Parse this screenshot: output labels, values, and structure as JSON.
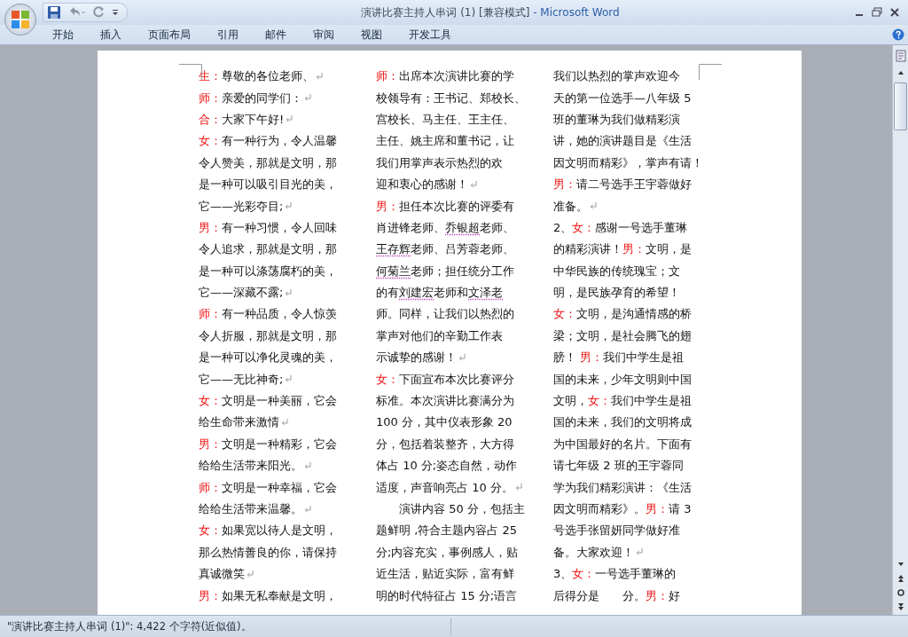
{
  "window": {
    "title_document": "演讲比赛主持人串词 (1) [兼容模式]",
    "title_app": "- Microsoft Word"
  },
  "ribbon_tabs": [
    {
      "label": "开始",
      "selected": false
    },
    {
      "label": "插入",
      "selected": false
    },
    {
      "label": "页面布局",
      "selected": false
    },
    {
      "label": "引用",
      "selected": false
    },
    {
      "label": "邮件",
      "selected": false
    },
    {
      "label": "审阅",
      "selected": false
    },
    {
      "label": "视图",
      "selected": false
    },
    {
      "label": "开发工具",
      "selected": false
    }
  ],
  "document": {
    "columns": [
      [
        {
          "segs": [
            {
              "kind": "speaker",
              "text": "生："
            },
            {
              "kind": "plain",
              "text": "尊敬的各位老师、"
            }
          ],
          "para_end": true
        },
        {
          "segs": [
            {
              "kind": "speaker",
              "text": "师："
            },
            {
              "kind": "plain",
              "text": "亲爱的同学们："
            }
          ],
          "para_end": true
        },
        {
          "segs": [
            {
              "kind": "speaker",
              "text": "合："
            },
            {
              "kind": "plain",
              "text": "大家下午好!"
            }
          ],
          "para_end": true
        },
        {
          "segs": [
            {
              "kind": "speaker",
              "text": "女："
            },
            {
              "kind": "plain",
              "text": "有一种行为，令人温馨"
            }
          ],
          "para_end": false
        },
        {
          "segs": [
            {
              "kind": "plain",
              "text": "令人赞美，那就是文明，那"
            }
          ],
          "para_end": false
        },
        {
          "segs": [
            {
              "kind": "plain",
              "text": "是一种可以吸引目光的美，"
            }
          ],
          "para_end": false
        },
        {
          "segs": [
            {
              "kind": "plain",
              "text": "它——光彩夺目;"
            }
          ],
          "para_end": true
        },
        {
          "segs": [
            {
              "kind": "speaker",
              "text": "男："
            },
            {
              "kind": "plain",
              "text": "有一种习惯，令人回味"
            }
          ],
          "para_end": false
        },
        {
          "segs": [
            {
              "kind": "plain",
              "text": "令人追求，那就是文明，那"
            }
          ],
          "para_end": false
        },
        {
          "segs": [
            {
              "kind": "plain",
              "text": "是一种可以涤荡腐朽的美，"
            }
          ],
          "para_end": false
        },
        {
          "segs": [
            {
              "kind": "plain",
              "text": "它——深藏不露;"
            }
          ],
          "para_end": true
        },
        {
          "segs": [
            {
              "kind": "speaker",
              "text": "师："
            },
            {
              "kind": "plain",
              "text": "有一种品质，令人惊羡"
            }
          ],
          "para_end": false
        },
        {
          "segs": [
            {
              "kind": "plain",
              "text": "令人折服，那就是文明，那"
            }
          ],
          "para_end": false
        },
        {
          "segs": [
            {
              "kind": "plain",
              "text": "是一种可以净化灵魂的美，"
            }
          ],
          "para_end": false
        },
        {
          "segs": [
            {
              "kind": "plain",
              "text": "它——无比神奇;"
            }
          ],
          "para_end": true
        },
        {
          "segs": [
            {
              "kind": "speaker",
              "text": "女："
            },
            {
              "kind": "plain",
              "text": "文明是一种美丽，它会"
            }
          ],
          "para_end": false
        },
        {
          "segs": [
            {
              "kind": "plain",
              "text": "给生命带来激情"
            }
          ],
          "para_end": true
        },
        {
          "segs": [
            {
              "kind": "speaker",
              "text": "男："
            },
            {
              "kind": "plain",
              "text": "文明是一种精彩，它会"
            }
          ],
          "para_end": false
        },
        {
          "segs": [
            {
              "kind": "plain",
              "text": "给给生活带来阳光。"
            }
          ],
          "para_end": true
        },
        {
          "segs": [
            {
              "kind": "speaker",
              "text": "师："
            },
            {
              "kind": "plain",
              "text": "文明是一种幸福，它会"
            }
          ],
          "para_end": false
        },
        {
          "segs": [
            {
              "kind": "plain",
              "text": "给给生活带来温馨。"
            }
          ],
          "para_end": true
        },
        {
          "segs": [
            {
              "kind": "speaker",
              "text": "女："
            },
            {
              "kind": "plain",
              "text": "如果宽以待人是文明，"
            }
          ],
          "para_end": false
        },
        {
          "segs": [
            {
              "kind": "plain",
              "text": "那么热情善良的你，请保持"
            }
          ],
          "para_end": false
        },
        {
          "segs": [
            {
              "kind": "plain",
              "text": "真诚微笑"
            }
          ],
          "para_end": true
        },
        {
          "segs": [
            {
              "kind": "speaker",
              "text": "男："
            },
            {
              "kind": "plain",
              "text": "如果无私奉献是文明，"
            }
          ],
          "para_end": false
        }
      ],
      [
        {
          "segs": [
            {
              "kind": "speaker",
              "text": "师："
            },
            {
              "kind": "plain",
              "text": "出席本次演讲比赛的学"
            }
          ],
          "para_end": false
        },
        {
          "segs": [
            {
              "kind": "plain",
              "text": "校领导有：王书记、郑校长、"
            }
          ],
          "para_end": false
        },
        {
          "segs": [
            {
              "kind": "plain",
              "text": "宫校长、马主任、王主任、"
            }
          ],
          "para_end": false
        },
        {
          "segs": [
            {
              "kind": "plain",
              "text": "主任、姚主席和董书记，让"
            }
          ],
          "para_end": false
        },
        {
          "segs": [
            {
              "kind": "plain",
              "text": "我们用掌声表示热烈的欢"
            }
          ],
          "para_end": false
        },
        {
          "segs": [
            {
              "kind": "plain",
              "text": "迎和衷心的感谢！"
            }
          ],
          "para_end": true
        },
        {
          "segs": [
            {
              "kind": "speaker",
              "text": "男："
            },
            {
              "kind": "plain",
              "text": "担任本次比赛的评委有"
            }
          ],
          "para_end": false
        },
        {
          "segs": [
            {
              "kind": "plain",
              "text": "肖进锋老师、"
            },
            {
              "kind": "flagged",
              "text": "乔银超"
            },
            {
              "kind": "plain",
              "text": "老师、"
            }
          ],
          "para_end": false
        },
        {
          "segs": [
            {
              "kind": "flagged",
              "text": "王存辉"
            },
            {
              "kind": "plain",
              "text": "老师、吕芳蓉老师、"
            }
          ],
          "para_end": false
        },
        {
          "segs": [
            {
              "kind": "flagged",
              "text": "何菊兰"
            },
            {
              "kind": "plain",
              "text": "老师；担任统分工作"
            }
          ],
          "para_end": false
        },
        {
          "segs": [
            {
              "kind": "plain",
              "text": "的有"
            },
            {
              "kind": "flagged",
              "text": "刘建宏"
            },
            {
              "kind": "plain",
              "text": "老师和"
            },
            {
              "kind": "flagged",
              "text": "文泽老"
            }
          ],
          "para_end": false
        },
        {
          "segs": [
            {
              "kind": "plain",
              "text": "师。同样，让我们以热烈的"
            }
          ],
          "para_end": false
        },
        {
          "segs": [
            {
              "kind": "plain",
              "text": "掌声对他们的辛勤工作表"
            }
          ],
          "para_end": false
        },
        {
          "segs": [
            {
              "kind": "plain",
              "text": "示诚挚的感谢！"
            }
          ],
          "para_end": true
        },
        {
          "segs": [
            {
              "kind": "speaker",
              "text": "女："
            },
            {
              "kind": "plain",
              "text": "下面宣布本次比赛评分"
            }
          ],
          "para_end": false
        },
        {
          "segs": [
            {
              "kind": "plain",
              "text": "标准。本次演讲比赛满分为"
            }
          ],
          "para_end": false
        },
        {
          "segs": [
            {
              "kind": "plain",
              "text": "100 分，其中仪表形象 20"
            }
          ],
          "para_end": false
        },
        {
          "segs": [
            {
              "kind": "plain",
              "text": "分，包括着装整齐，大方得"
            }
          ],
          "para_end": false
        },
        {
          "segs": [
            {
              "kind": "plain",
              "text": "体占 10 分;姿态自然，动作"
            }
          ],
          "para_end": false
        },
        {
          "segs": [
            {
              "kind": "plain",
              "text": "适度，声音响亮占 10 分。"
            }
          ],
          "para_end": true
        },
        {
          "segs": [
            {
              "kind": "plain",
              "text": "　　演讲内容 50 分，包括主"
            }
          ],
          "para_end": false
        },
        {
          "segs": [
            {
              "kind": "plain",
              "text": "题鲜明 ,符合主题内容占 25"
            }
          ],
          "para_end": false
        },
        {
          "segs": [
            {
              "kind": "plain",
              "text": "分;内容充实，事例感人，贴"
            }
          ],
          "para_end": false
        },
        {
          "segs": [
            {
              "kind": "plain",
              "text": "近生活，贴近实际，富有鲜"
            }
          ],
          "para_end": false
        },
        {
          "segs": [
            {
              "kind": "plain",
              "text": "明的时代特征占 15 分;语言"
            }
          ],
          "para_end": false
        }
      ],
      [
        {
          "segs": [
            {
              "kind": "plain",
              "text": "我们以热烈的掌声欢迎今"
            }
          ],
          "para_end": false
        },
        {
          "segs": [
            {
              "kind": "plain",
              "text": "天的第一位选手—八年级 5"
            }
          ],
          "para_end": false
        },
        {
          "segs": [
            {
              "kind": "plain",
              "text": "班的董琳为我们做精彩演"
            }
          ],
          "para_end": false
        },
        {
          "segs": [
            {
              "kind": "plain",
              "text": "讲，她的演讲题目是《生活"
            }
          ],
          "para_end": false
        },
        {
          "segs": [
            {
              "kind": "plain",
              "text": "因文明而精彩》，掌声有请！"
            }
          ],
          "para_end": false
        },
        {
          "segs": [
            {
              "kind": "speaker",
              "text": "男："
            },
            {
              "kind": "plain",
              "text": "请二号选手王宇蓉做好"
            }
          ],
          "para_end": false
        },
        {
          "segs": [
            {
              "kind": "plain",
              "text": "准备。"
            }
          ],
          "para_end": true
        },
        {
          "segs": [
            {
              "kind": "plain",
              "text": "2、"
            },
            {
              "kind": "speaker",
              "text": "女："
            },
            {
              "kind": "plain",
              "text": "感谢一号选手董琳"
            }
          ],
          "para_end": false
        },
        {
          "segs": [
            {
              "kind": "plain",
              "text": "的精彩演讲！"
            },
            {
              "kind": "speaker",
              "text": "男："
            },
            {
              "kind": "plain",
              "text": "文明，是"
            }
          ],
          "para_end": false
        },
        {
          "segs": [
            {
              "kind": "plain",
              "text": "中华民族的传统瑰宝；文"
            }
          ],
          "para_end": false
        },
        {
          "segs": [
            {
              "kind": "plain",
              "text": "明，是民族孕育的希望！"
            }
          ],
          "para_end": false
        },
        {
          "segs": [
            {
              "kind": "speaker",
              "text": "女："
            },
            {
              "kind": "plain",
              "text": "文明，是沟通情感的桥"
            }
          ],
          "para_end": false
        },
        {
          "segs": [
            {
              "kind": "plain",
              "text": "梁；文明，是社会腾飞的翅"
            }
          ],
          "para_end": false
        },
        {
          "segs": [
            {
              "kind": "plain",
              "text": "膀！ "
            },
            {
              "kind": "speaker",
              "text": "男："
            },
            {
              "kind": "plain",
              "text": "我们中学生是祖"
            }
          ],
          "para_end": false
        },
        {
          "segs": [
            {
              "kind": "plain",
              "text": "国的未来，少年文明则中国"
            }
          ],
          "para_end": false
        },
        {
          "segs": [
            {
              "kind": "plain",
              "text": "文明，"
            },
            {
              "kind": "speaker",
              "text": "女："
            },
            {
              "kind": "plain",
              "text": "我们中学生是祖"
            }
          ],
          "para_end": false
        },
        {
          "segs": [
            {
              "kind": "plain",
              "text": "国的未来，我们的文明将成"
            }
          ],
          "para_end": false
        },
        {
          "segs": [
            {
              "kind": "plain",
              "text": "为中国最好的名片。下面有"
            }
          ],
          "para_end": false
        },
        {
          "segs": [
            {
              "kind": "plain",
              "text": "请七年级 2 班的王宇蓉同"
            }
          ],
          "para_end": false
        },
        {
          "segs": [
            {
              "kind": "plain",
              "text": "学为我们精彩演讲：《生活"
            }
          ],
          "para_end": false
        },
        {
          "segs": [
            {
              "kind": "plain",
              "text": "因文明而精彩》。"
            },
            {
              "kind": "speaker",
              "text": "男："
            },
            {
              "kind": "plain",
              "text": "请 3"
            }
          ],
          "para_end": false
        },
        {
          "segs": [
            {
              "kind": "plain",
              "text": "号选手张留妍同学做好准"
            }
          ],
          "para_end": false
        },
        {
          "segs": [
            {
              "kind": "plain",
              "text": "备。大家欢迎！"
            }
          ],
          "para_end": true
        },
        {
          "segs": [
            {
              "kind": "plain",
              "text": "3、"
            },
            {
              "kind": "speaker",
              "text": "女："
            },
            {
              "kind": "plain",
              "text": "一号选手董琳的"
            }
          ],
          "para_end": false
        },
        {
          "segs": [
            {
              "kind": "plain",
              "text": "后得分是　　分。"
            },
            {
              "kind": "speaker",
              "text": "男："
            },
            {
              "kind": "plain",
              "text": "好"
            }
          ],
          "para_end": false
        }
      ]
    ]
  },
  "status_bar": {
    "text": "\"演讲比赛主持人串词 (1)\": 4,422 个字符(近似值)。"
  }
}
